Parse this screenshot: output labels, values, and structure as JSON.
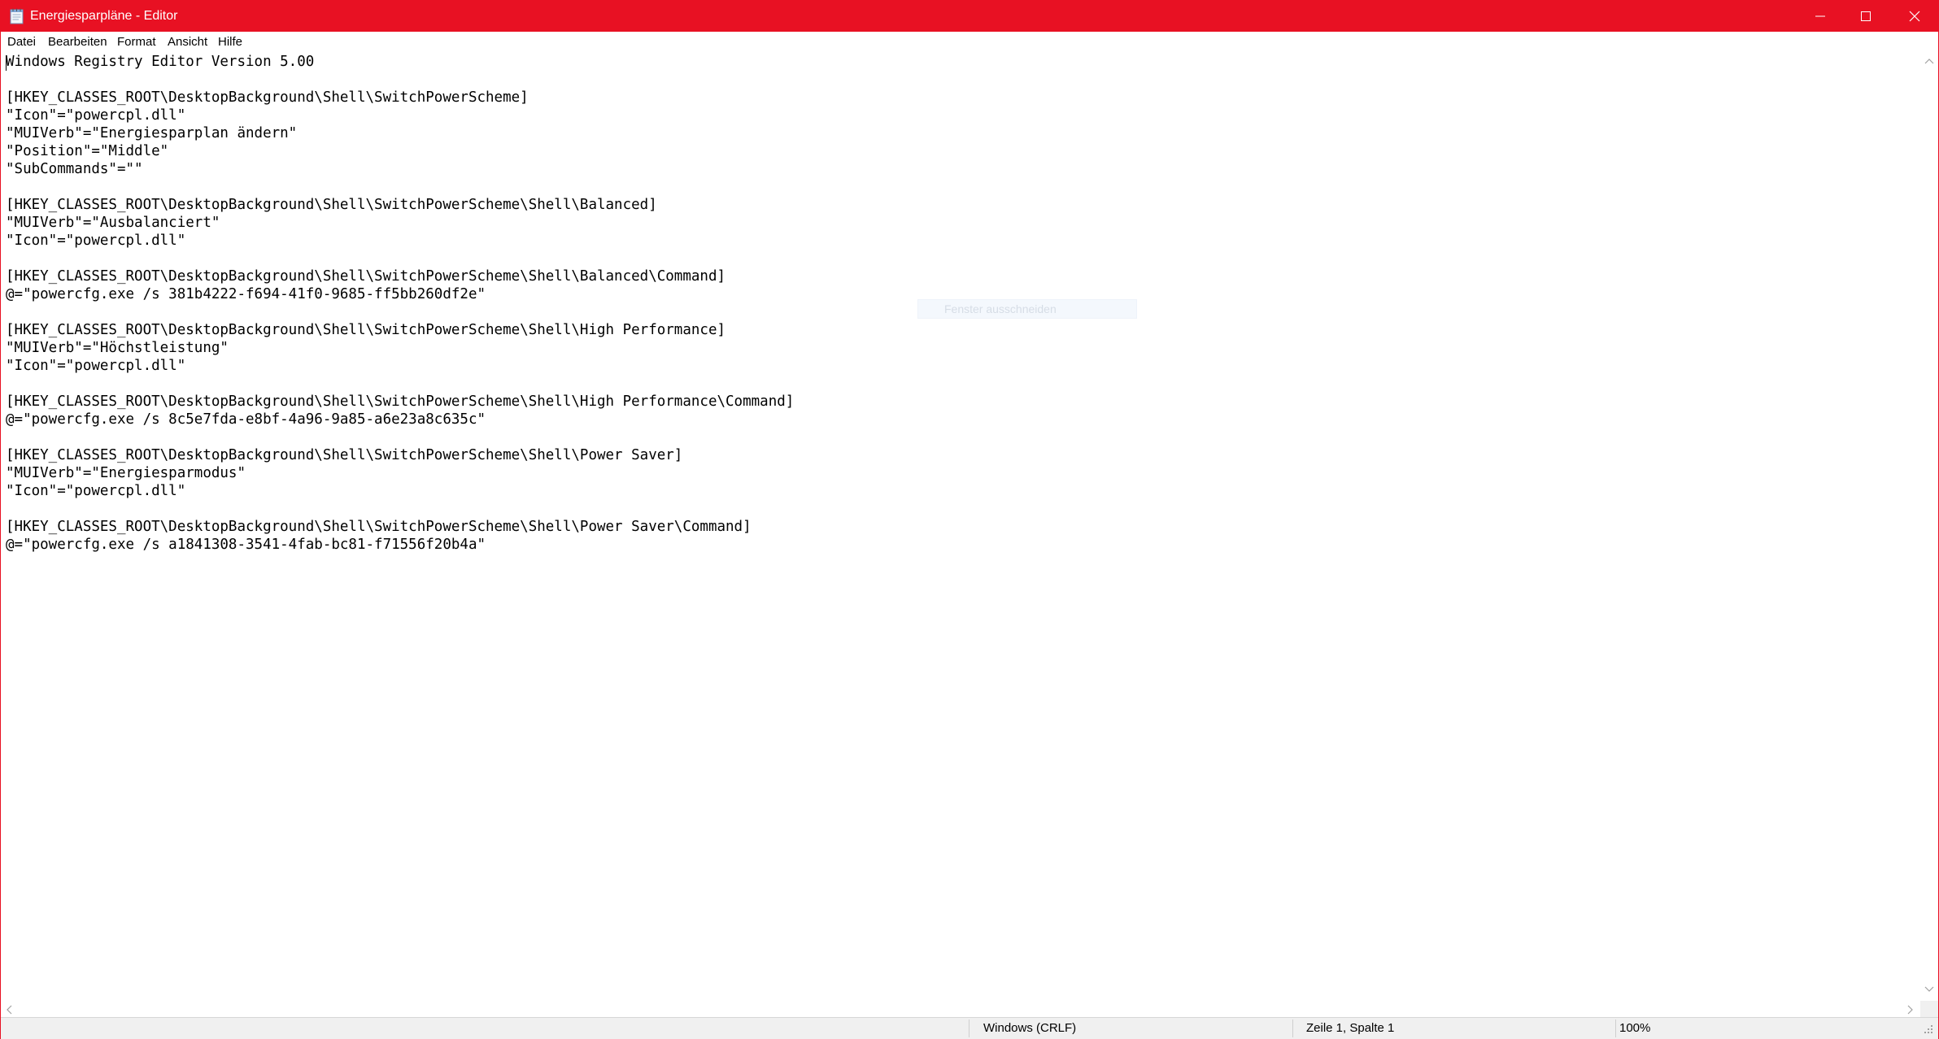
{
  "window": {
    "title": "Energiesparpläne - Editor",
    "accent_color": "#e81123",
    "app_icon": "notepad-icon"
  },
  "menu": {
    "items": [
      {
        "label": "Datei"
      },
      {
        "label": "Bearbeiten"
      },
      {
        "label": "Format"
      },
      {
        "label": "Ansicht"
      },
      {
        "label": "Hilfe"
      }
    ]
  },
  "editor": {
    "content": "Windows Registry Editor Version 5.00\n\n[HKEY_CLASSES_ROOT\\DesktopBackground\\Shell\\SwitchPowerScheme]\n\"Icon\"=\"powercpl.dll\"\n\"MUIVerb\"=\"Energiesparplan ändern\"\n\"Position\"=\"Middle\"\n\"SubCommands\"=\"\"\n\n[HKEY_CLASSES_ROOT\\DesktopBackground\\Shell\\SwitchPowerScheme\\Shell\\Balanced]\n\"MUIVerb\"=\"Ausbalanciert\"\n\"Icon\"=\"powercpl.dll\"\n\n[HKEY_CLASSES_ROOT\\DesktopBackground\\Shell\\SwitchPowerScheme\\Shell\\Balanced\\Command]\n@=\"powercfg.exe /s 381b4222-f694-41f0-9685-ff5bb260df2e\"\n\n[HKEY_CLASSES_ROOT\\DesktopBackground\\Shell\\SwitchPowerScheme\\Shell\\High Performance]\n\"MUIVerb\"=\"Höchstleistung\"\n\"Icon\"=\"powercpl.dll\"\n\n[HKEY_CLASSES_ROOT\\DesktopBackground\\Shell\\SwitchPowerScheme\\Shell\\High Performance\\Command]\n@=\"powercfg.exe /s 8c5e7fda-e8bf-4a96-9a85-a6e23a8c635c\"\n\n[HKEY_CLASSES_ROOT\\DesktopBackground\\Shell\\SwitchPowerScheme\\Shell\\Power Saver]\n\"MUIVerb\"=\"Energiesparmodus\"\n\"Icon\"=\"powercpl.dll\"\n\n[HKEY_CLASSES_ROOT\\DesktopBackground\\Shell\\SwitchPowerScheme\\Shell\\Power Saver\\Command]\n@=\"powercfg.exe /s a1841308-3541-4fab-bc81-f71556f20b4a\""
  },
  "tooltip": {
    "text": "Fenster ausschneiden"
  },
  "statusbar": {
    "encoding": "Windows (CRLF)",
    "position": "Zeile 1, Spalte 1",
    "zoom": "100%"
  }
}
